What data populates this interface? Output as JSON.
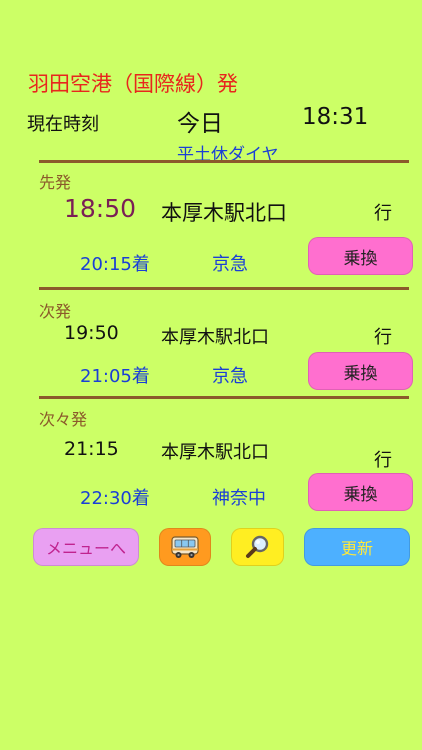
{
  "header": {
    "title": "羽田空港（国際線）発",
    "now_label": "現在時刻",
    "day": "今日",
    "time": "18:31",
    "schedule": "平土休ダイヤ"
  },
  "departures": [
    {
      "label": "先発",
      "time": "18:50",
      "destination": "本厚木駅北口",
      "bound": "行",
      "arrival": "20:15着",
      "operator": "京急",
      "transfer_label": "乗換"
    },
    {
      "label": "次発",
      "time": "19:50",
      "destination": "本厚木駅北口",
      "bound": "行",
      "arrival": "21:05着",
      "operator": "京急",
      "transfer_label": "乗換"
    },
    {
      "label": "次々発",
      "time": "21:15",
      "destination": "本厚木駅北口",
      "bound": "行",
      "arrival": "22:30着",
      "operator": "神奈中",
      "transfer_label": "乗換"
    }
  ],
  "footer": {
    "menu_label": "メニューへ",
    "refresh_label": "更新",
    "bus_icon": "bus-icon",
    "search_icon": "magnifier-icon"
  },
  "colors": {
    "background": "#CCFF66",
    "title": "#E8261D",
    "blue_text": "#1A3FD6",
    "divider": "#8B5A2B",
    "transfer_button": "#FF6FCF",
    "menu_button": "#E9A0F2",
    "bus_button": "#FF9A1F",
    "search_button": "#FFEE22",
    "refresh_button": "#4DB0FF"
  }
}
